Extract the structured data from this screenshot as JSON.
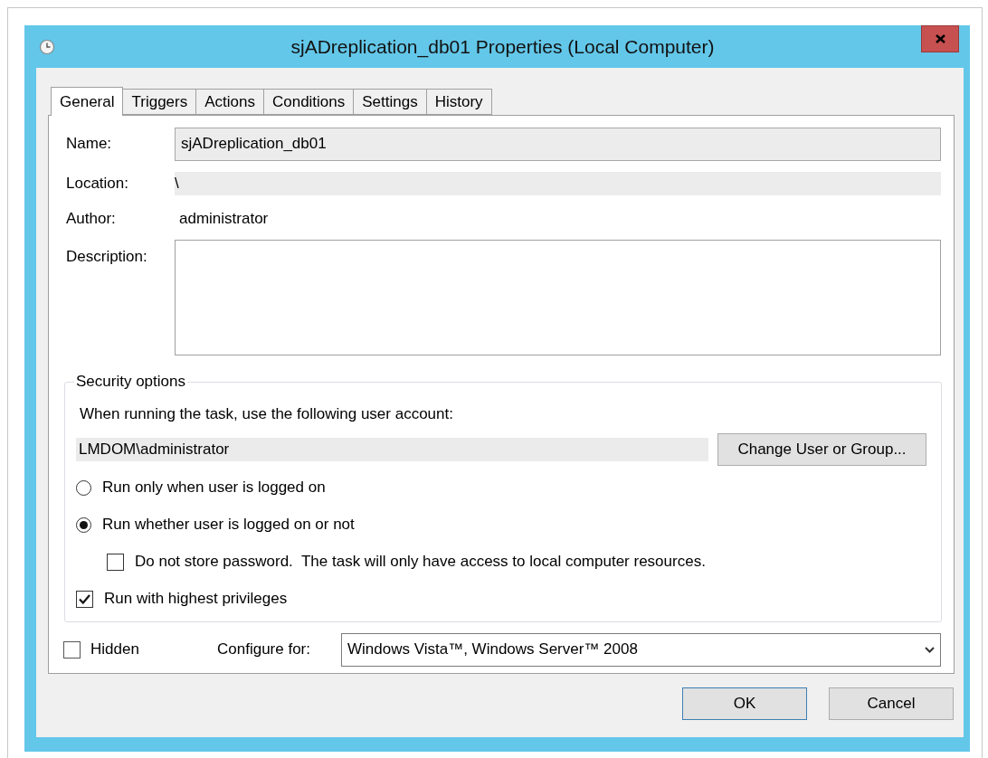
{
  "window": {
    "title": "sjADreplication_db01 Properties (Local Computer)"
  },
  "tabs": [
    {
      "label": "General",
      "selected": true
    },
    {
      "label": "Triggers",
      "selected": false
    },
    {
      "label": "Actions",
      "selected": false
    },
    {
      "label": "Conditions",
      "selected": false
    },
    {
      "label": "Settings",
      "selected": false
    },
    {
      "label": "History",
      "selected": false
    }
  ],
  "general": {
    "name_label": "Name:",
    "name_value": "sjADreplication_db01",
    "location_label": "Location:",
    "location_value": "\\",
    "author_label": "Author:",
    "author_value": "administrator",
    "description_label": "Description:"
  },
  "security_options": {
    "title": "Security options",
    "account_prompt": "When running the task, use the following user account:",
    "account": "LMDOM\\administrator",
    "change_button": "Change User or Group...",
    "options": [
      {
        "kind": "radio",
        "label": "Run only when user is logged on",
        "selected": false
      },
      {
        "kind": "radio",
        "label": "Run whether user is logged on or not",
        "selected": true,
        "children": [
          {
            "kind": "checkbox",
            "label": "Do not store password.  The task will only have access to local computer resources.",
            "checked": false
          }
        ]
      },
      {
        "kind": "checkbox",
        "label": "Run with highest privileges",
        "checked": true
      }
    ]
  },
  "hidden": {
    "label": "Hidden",
    "checked": false
  },
  "configure_for": {
    "label": "Configure for:",
    "value": "Windows Vista™, Windows Server™ 2008"
  },
  "buttons": [
    {
      "label": "OK",
      "default": true
    },
    {
      "label": "Cancel",
      "default": false
    }
  ]
}
